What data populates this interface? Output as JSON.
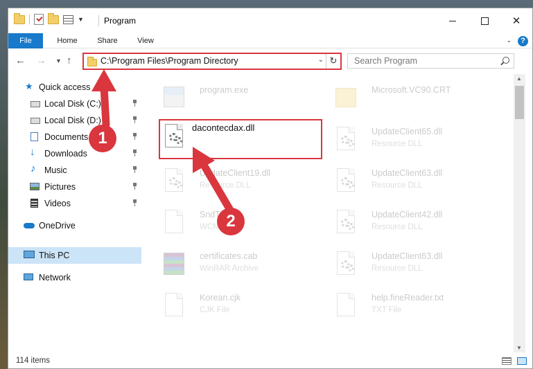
{
  "window": {
    "title": "Program",
    "controls": {
      "minimize": "",
      "maximize": "",
      "close": "✕"
    }
  },
  "ribbon": {
    "tabs": [
      "File",
      "Home",
      "Share",
      "View"
    ]
  },
  "navigation": {
    "address": "C:\\Program Files\\Program Directory",
    "search_placeholder": "Search Program"
  },
  "sidebar": {
    "items": [
      {
        "label": "Quick access",
        "icon": "star-icon",
        "pinned": false
      },
      {
        "label": "Local Disk (C:)",
        "icon": "drive-icon",
        "pinned": true
      },
      {
        "label": "Local Disk (D:)",
        "icon": "drive-icon",
        "pinned": true
      },
      {
        "label": "Documents",
        "icon": "documents-icon",
        "pinned": true
      },
      {
        "label": "Downloads",
        "icon": "download-icon",
        "pinned": true
      },
      {
        "label": "Music",
        "icon": "music-icon",
        "pinned": true
      },
      {
        "label": "Pictures",
        "icon": "pictures-icon",
        "pinned": true
      },
      {
        "label": "Videos",
        "icon": "videos-icon",
        "pinned": true
      },
      {
        "label": "OneDrive",
        "icon": "cloud-icon",
        "pinned": false
      },
      {
        "label": "This PC",
        "icon": "computer-icon",
        "pinned": false,
        "selected": true
      },
      {
        "label": "Network",
        "icon": "network-icon",
        "pinned": false
      }
    ]
  },
  "files": [
    {
      "name": "program.exe",
      "type": "",
      "icon": "exe-icon"
    },
    {
      "name": "Microsoft.VC90.CRT",
      "type": "",
      "icon": "folder-icon"
    },
    {
      "name": "dacontecdax.dll",
      "type": "",
      "icon": "dll-icon",
      "highlighted": true
    },
    {
      "name": "UpdateClient65.dll",
      "type": "Resource DLL",
      "icon": "dll-icon"
    },
    {
      "name": "UpdateClient19.dll",
      "type": "Resource DLL",
      "icon": "dll-icon"
    },
    {
      "name": "UpdateClient63.dll",
      "type": "Resource DLL",
      "icon": "dll-icon"
    },
    {
      "name": "SndTo...",
      "type": "WCM File",
      "icon": "file-icon"
    },
    {
      "name": "UpdateClient42.dll",
      "type": "Resource DLL",
      "icon": "dll-icon"
    },
    {
      "name": "certificates.cab",
      "type": "WinRAR Archive",
      "icon": "archive-icon"
    },
    {
      "name": "UpdateClient63.dll",
      "type": "Resource DLL",
      "icon": "dll-icon"
    },
    {
      "name": "Korean.cjk",
      "type": "CJK File",
      "icon": "file-icon"
    },
    {
      "name": "help.fineReader.txt",
      "type": "TXT File",
      "icon": "text-icon"
    }
  ],
  "annotations": {
    "step1": "1",
    "step2": "2"
  },
  "statusbar": {
    "item_count": "114 items"
  },
  "colors": {
    "accent": "#1979ca",
    "highlight": "#d9363e",
    "selection": "#cce4f7"
  }
}
